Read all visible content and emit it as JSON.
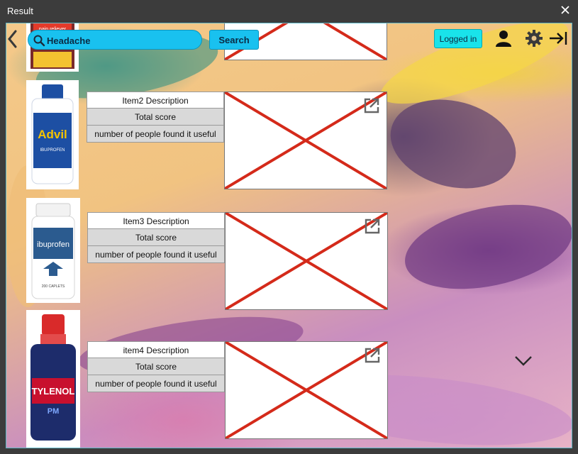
{
  "window": {
    "title": "Result",
    "close_icon": "close-icon"
  },
  "toolbar": {
    "back_icon": "chevron-left-icon",
    "search": {
      "value": "Headache",
      "icon": "search-icon"
    },
    "search_label": "Search",
    "logged_in_label": "Logged in",
    "user_icon": "user-icon",
    "settings_icon": "gear-icon",
    "logout_icon": "sign-out-arrow-icon"
  },
  "items": [
    {
      "product_name": "Advil",
      "label_line": "IBUPROFEN",
      "description": "Item2 Description",
      "score_label": "Total score",
      "useful_label": "number of people found it useful",
      "accent": "#1d4fa3"
    },
    {
      "product_name": "ibuprofen",
      "label_line": "200 CAPLETS",
      "description": "Item3 Description",
      "score_label": "Total score",
      "useful_label": "number of people found it useful",
      "accent": "#2b5b8f"
    },
    {
      "product_name": "TYLENOL",
      "label_line": "PM",
      "description": "item4 Description",
      "score_label": "Total score",
      "useful_label": "number of people found it useful",
      "accent": "#c8102e"
    }
  ],
  "partial_top_item": {
    "label_line": "pain reliever"
  },
  "scroll": {
    "icon": "chevron-down-icon"
  },
  "colors": {
    "accent_cyan": "#19c1ef",
    "logged_in_cyan": "#19e3ea",
    "placeholder_x": "#d42a1a"
  }
}
